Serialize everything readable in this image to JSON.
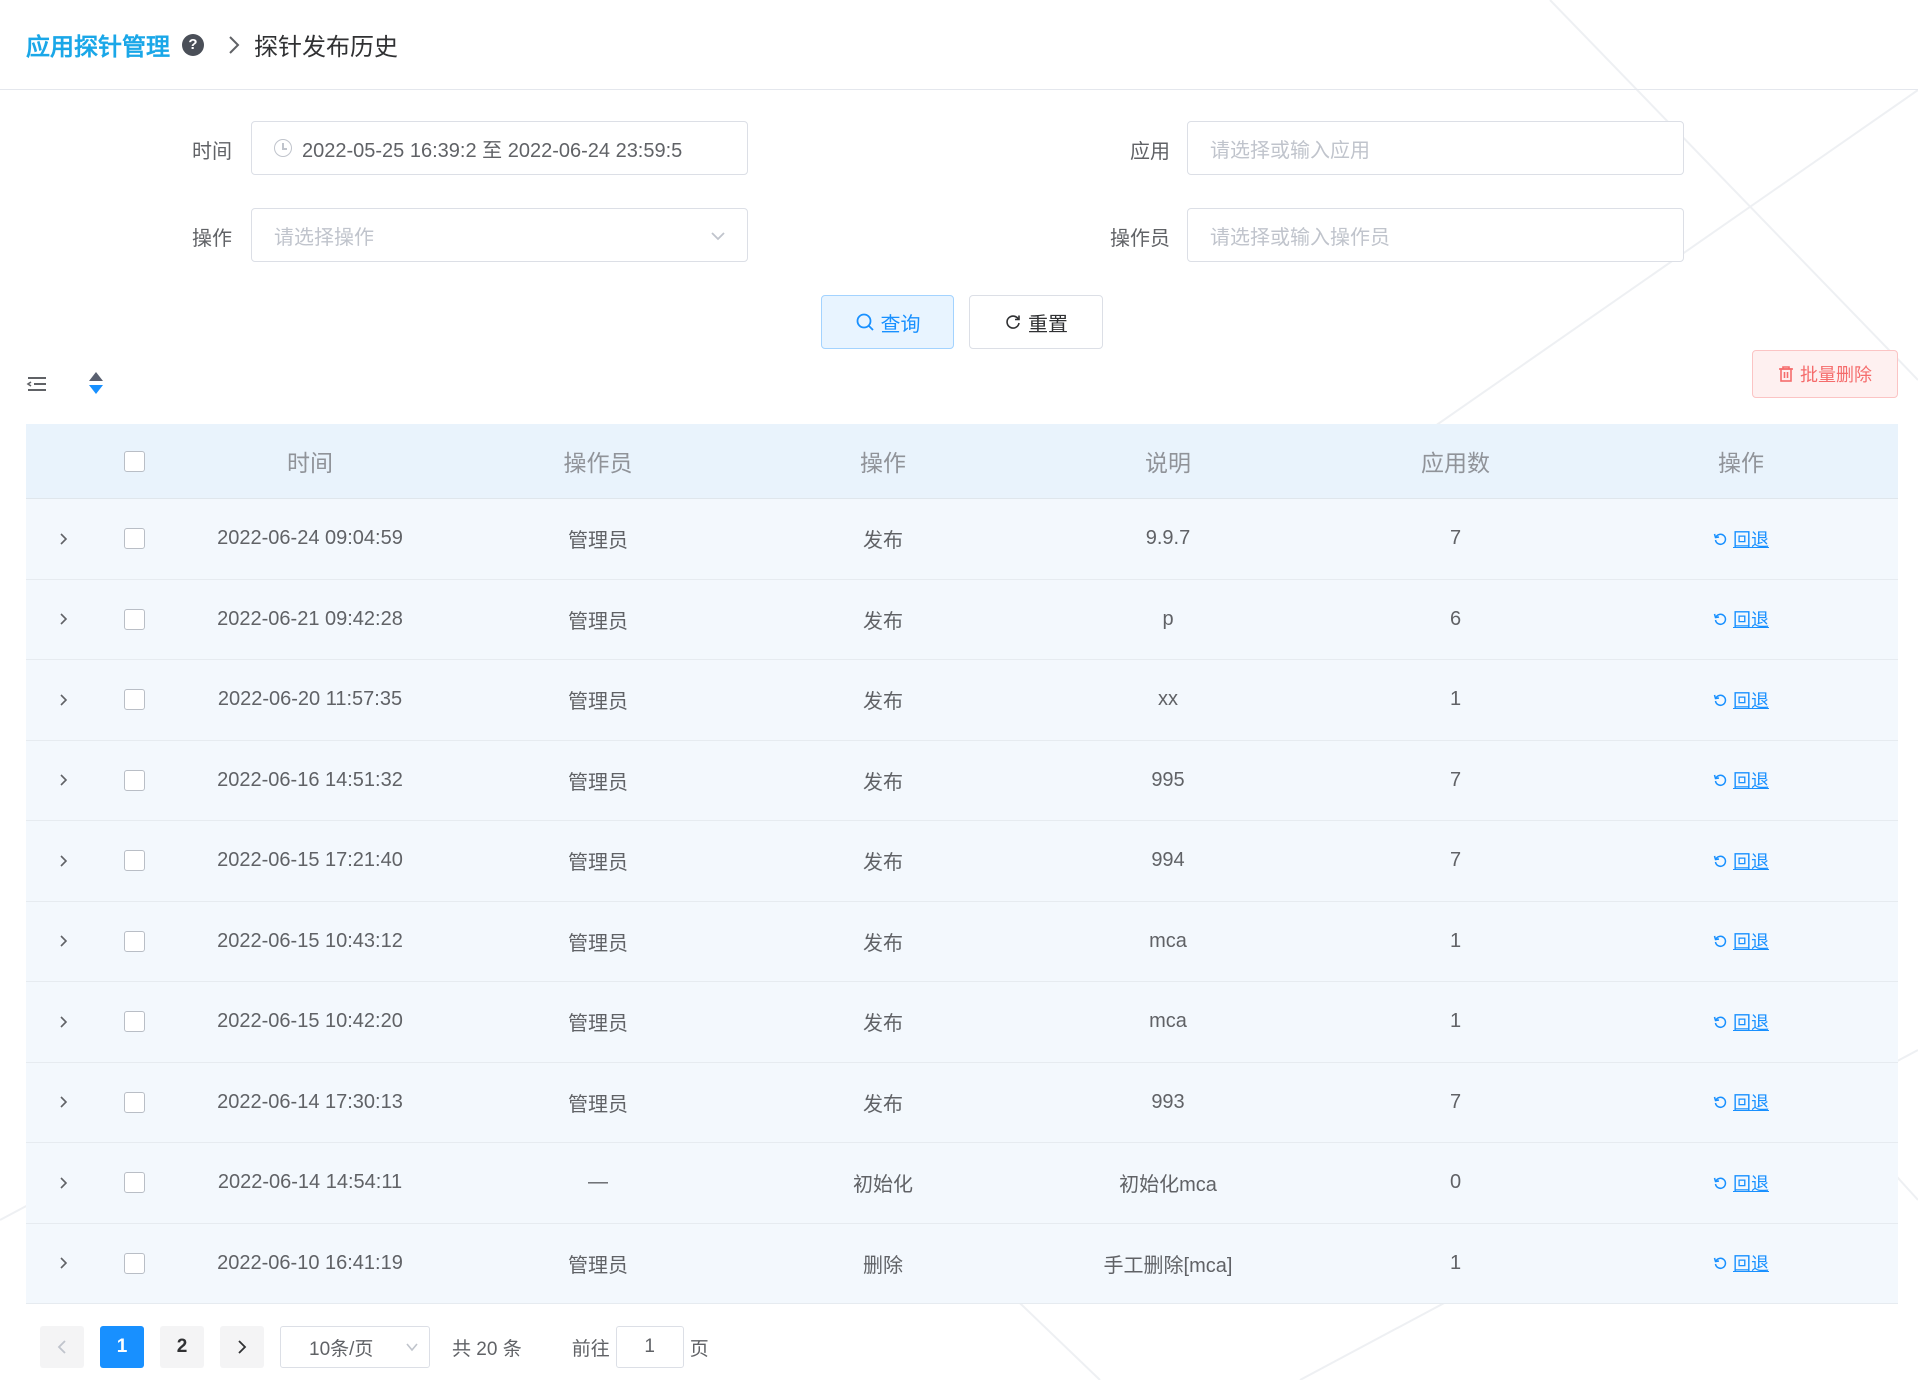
{
  "breadcrumb": {
    "root": "应用探针管理",
    "current": "探针发布历史",
    "help": "?"
  },
  "filters": {
    "time_label": "时间",
    "time_value": "2022-05-25 16:39:2 至 2022-06-24 23:59:5",
    "app_label": "应用",
    "app_placeholder": "请选择或输入应用",
    "op_label": "操作",
    "op_placeholder": "请选择操作",
    "operator_label": "操作员",
    "operator_placeholder": "请选择或输入操作员"
  },
  "buttons": {
    "query": "查询",
    "reset": "重置",
    "batch_delete": "批量删除"
  },
  "table": {
    "headers": [
      "时间",
      "操作员",
      "操作",
      "说明",
      "应用数",
      "操作"
    ],
    "rows": [
      {
        "time": "2022-06-24 09:04:59",
        "operator": "管理员",
        "action": "发布",
        "desc": "9.9.7",
        "count": "7",
        "op": "回退"
      },
      {
        "time": "2022-06-21 09:42:28",
        "operator": "管理员",
        "action": "发布",
        "desc": "p",
        "count": "6",
        "op": "回退"
      },
      {
        "time": "2022-06-20 11:57:35",
        "operator": "管理员",
        "action": "发布",
        "desc": "xx",
        "count": "1",
        "op": "回退"
      },
      {
        "time": "2022-06-16 14:51:32",
        "operator": "管理员",
        "action": "发布",
        "desc": "995",
        "count": "7",
        "op": "回退"
      },
      {
        "time": "2022-06-15 17:21:40",
        "operator": "管理员",
        "action": "发布",
        "desc": "994",
        "count": "7",
        "op": "回退"
      },
      {
        "time": "2022-06-15 10:43:12",
        "operator": "管理员",
        "action": "发布",
        "desc": "mca",
        "count": "1",
        "op": "回退"
      },
      {
        "time": "2022-06-15 10:42:20",
        "operator": "管理员",
        "action": "发布",
        "desc": "mca",
        "count": "1",
        "op": "回退"
      },
      {
        "time": "2022-06-14 17:30:13",
        "operator": "管理员",
        "action": "发布",
        "desc": "993",
        "count": "7",
        "op": "回退"
      },
      {
        "time": "2022-06-14 14:54:11",
        "operator": "—",
        "action": "初始化",
        "desc": "初始化mca",
        "count": "0",
        "op": "回退"
      },
      {
        "time": "2022-06-10 16:41:19",
        "operator": "管理员",
        "action": "删除",
        "desc": "手工删除[mca]",
        "count": "1",
        "op": "回退"
      }
    ]
  },
  "pagination": {
    "prev": "<",
    "next": ">",
    "pages": [
      "1",
      "2"
    ],
    "current_page": "1",
    "page_size": "10条/页",
    "total": "共 20 条",
    "goto_prefix": "前往",
    "goto_value": "1",
    "goto_suffix": "页"
  },
  "colors": {
    "accent": "#1890ff",
    "brand": "#1aa7e8",
    "danger": "#f56c6c",
    "header_bg": "#e9f3fc",
    "row_bg": "#f3f8fd"
  }
}
